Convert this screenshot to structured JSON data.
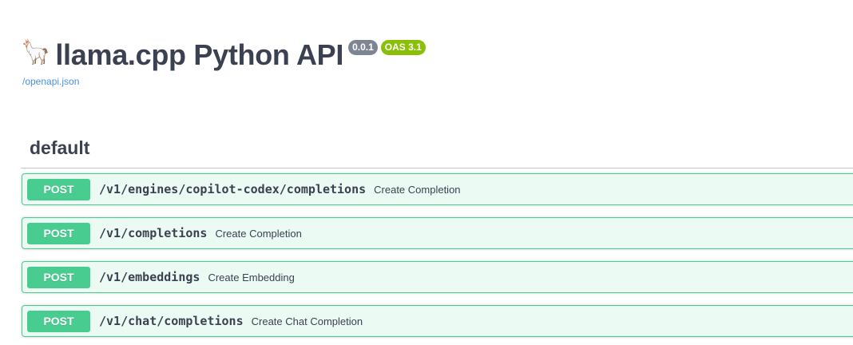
{
  "info": {
    "icon": "llama-emoji",
    "emoji": "🦙",
    "title": "llama.cpp Python API",
    "version": "0.0.1",
    "oas_version": "OAS 3.1",
    "spec_link": "/openapi.json"
  },
  "tag": {
    "name": "default"
  },
  "colors": {
    "post": "#49cc90",
    "version_badge": "#7d8492",
    "oas_badge": "#89bf04",
    "link": "#4990e2"
  },
  "operations": [
    {
      "method": "POST",
      "path": "/v1/engines/copilot-codex/completions",
      "summary": "Create Completion"
    },
    {
      "method": "POST",
      "path": "/v1/completions",
      "summary": "Create Completion"
    },
    {
      "method": "POST",
      "path": "/v1/embeddings",
      "summary": "Create Embedding"
    },
    {
      "method": "POST",
      "path": "/v1/chat/completions",
      "summary": "Create Chat Completion"
    }
  ]
}
